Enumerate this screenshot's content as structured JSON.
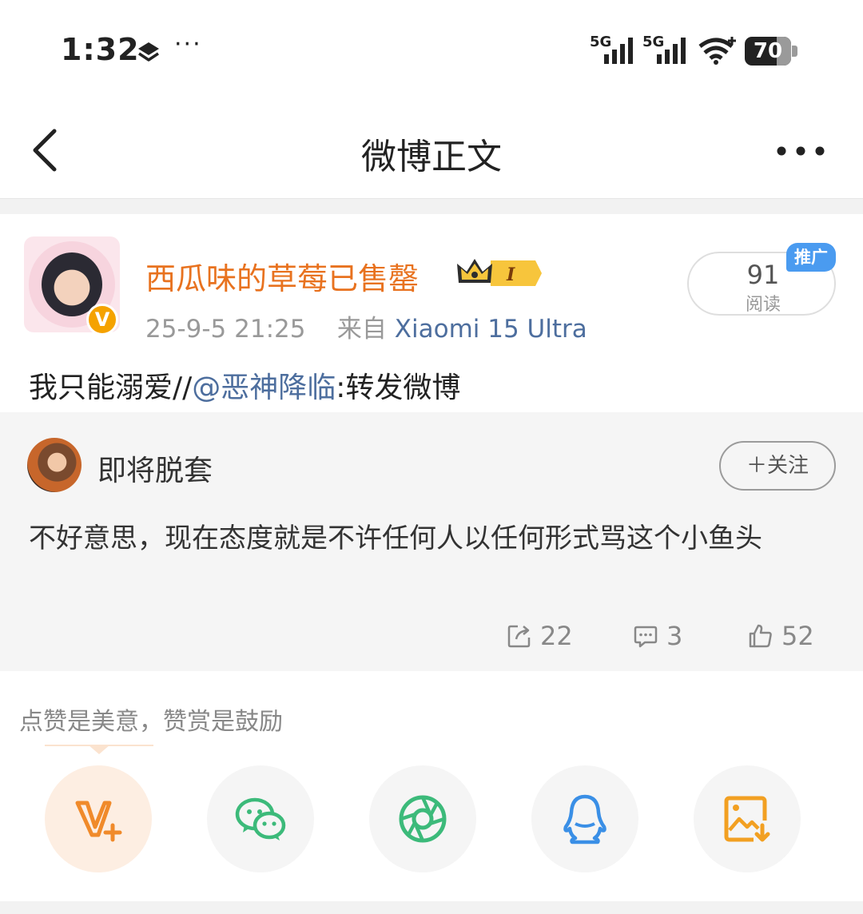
{
  "status_bar": {
    "time": "1:32",
    "more": "···",
    "net1": "5G",
    "net2": "5G",
    "battery": "70"
  },
  "nav": {
    "title": "微博正文"
  },
  "post": {
    "username": "西瓜味的草莓已售罄",
    "timestamp": "25-9-5 21:25",
    "source_prefix": "来自",
    "device": "Xiaomi 15 Ultra",
    "reads_count": "91",
    "reads_label": "阅读",
    "promo_tag": "推广",
    "text_before": "我只能溺爱//",
    "mention": "@恶神降临",
    "text_after": ":转发微博"
  },
  "retweet": {
    "username": "即将脱套",
    "follow_label": "＋关注",
    "text": "不好意思，现在态度就是不许任何人以任何形式骂这个小鱼头",
    "reposts": "22",
    "comments": "3",
    "likes": "52"
  },
  "reward": {
    "hint": "点赞是美意，赞赏是鼓励"
  },
  "colors": {
    "username": "#e8721f",
    "link": "#4d6e9e",
    "promo": "#4a9bf0",
    "wechat": "#3cba7a",
    "qq": "#3a8fe6",
    "vip": "#f08a2a"
  },
  "icons": [
    "back-icon",
    "more-icon",
    "repost-icon",
    "comment-icon",
    "like-icon",
    "vip-reward-icon",
    "wechat-icon",
    "moments-icon",
    "qq-icon",
    "save-image-icon"
  ]
}
